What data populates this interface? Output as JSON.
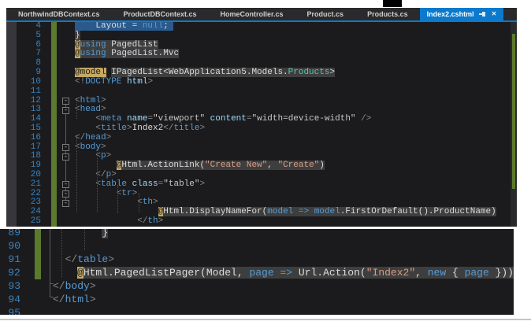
{
  "colors": {
    "accent_blue": "#0b79cc",
    "editor_bg": "#1b1b1d",
    "tab_bg": "#2a2a2c",
    "selection_blue": "#2a5a8c",
    "razor_code_bg": "#3e3e3e",
    "razor_at_bg": "#c4a962",
    "change_bar_green": "#5c7a2d",
    "keyword_blue": "#569cd6",
    "string_brown": "#d69d85",
    "type_teal": "#4ec9b0",
    "line_number_blue": "#3a83c0"
  },
  "tabbar": {
    "tabs": [
      {
        "label": "NorthwindDBContext.cs",
        "active": false
      },
      {
        "label": "ProductDBContext.cs",
        "active": false
      },
      {
        "label": "HomeController.cs",
        "active": false
      },
      {
        "label": "Product.cs",
        "active": false
      },
      {
        "label": "Products.cs",
        "active": false
      },
      {
        "label": "Index2.cshtml",
        "active": true,
        "icons": [
          "pin-icon",
          "close-icon"
        ]
      }
    ]
  },
  "editor_top": {
    "lines": [
      {
        "n": 4,
        "green": true,
        "tokens": [
          {
            "t": "    ",
            "b": "sel"
          },
          {
            "t": "Layout = ",
            "c": "id",
            "b": "sel"
          },
          {
            "t": "null",
            "c": "kw",
            "b": "sel"
          },
          {
            "t": ";",
            "c": "id",
            "b": "sel"
          },
          {
            "t": " ",
            "b": "sel"
          }
        ]
      },
      {
        "n": 5,
        "green": true,
        "tokens": [
          {
            "t": "}",
            "c": "id",
            "b": "ray"
          }
        ]
      },
      {
        "n": 6,
        "green": true,
        "tokens": [
          {
            "t": "@",
            "c": "at",
            "b": "at"
          },
          {
            "t": "using",
            "c": "kw",
            "b": "ray"
          },
          {
            "t": " PagedList",
            "c": "id",
            "b": "ray"
          }
        ]
      },
      {
        "n": 7,
        "green": true,
        "tokens": [
          {
            "t": "@",
            "c": "at",
            "b": "at"
          },
          {
            "t": "using",
            "c": "kw",
            "b": "ray"
          },
          {
            "t": " PagedList.Mvc",
            "c": "id",
            "b": "ray"
          }
        ]
      },
      {
        "n": 8,
        "green": true,
        "tokens": []
      },
      {
        "n": 9,
        "green": true,
        "tokens": [
          {
            "t": "@model",
            "c": "at",
            "b": "at"
          },
          {
            "t": " "
          },
          {
            "t": "IPagedList<WebApplication5.Models.",
            "c": "id",
            "b": "ray"
          },
          {
            "t": "Products",
            "c": "type",
            "b": "ray"
          },
          {
            "t": ">",
            "c": "id",
            "b": "ray"
          }
        ]
      },
      {
        "n": 10,
        "green": true,
        "tokens": [
          {
            "t": "<!",
            "c": "pun"
          },
          {
            "t": "DOCTYPE",
            "c": "kw"
          },
          {
            "t": " "
          },
          {
            "t": "html",
            "c": "attr"
          },
          {
            "t": ">",
            "c": "pun"
          }
        ]
      },
      {
        "n": 11,
        "green": true,
        "tokens": []
      },
      {
        "n": 12,
        "green": true,
        "fold": true,
        "tokens": [
          {
            "t": "<",
            "c": "pun"
          },
          {
            "t": "html",
            "c": "tag"
          },
          {
            "t": ">",
            "c": "pun"
          }
        ]
      },
      {
        "n": 13,
        "green": true,
        "fold": true,
        "tokens": [
          {
            "t": "<",
            "c": "pun"
          },
          {
            "t": "head",
            "c": "tag"
          },
          {
            "t": ">",
            "c": "pun"
          }
        ]
      },
      {
        "n": 14,
        "green": true,
        "tokens": [
          {
            "t": "    "
          },
          {
            "t": "<",
            "c": "pun"
          },
          {
            "t": "meta",
            "c": "tag"
          },
          {
            "t": " "
          },
          {
            "t": "name",
            "c": "attr"
          },
          {
            "t": "=",
            "c": "pun"
          },
          {
            "t": "\"viewport\"",
            "c": "aval"
          },
          {
            "t": " "
          },
          {
            "t": "content",
            "c": "attr"
          },
          {
            "t": "=",
            "c": "pun"
          },
          {
            "t": "\"width=device-width\"",
            "c": "aval"
          },
          {
            "t": " "
          },
          {
            "t": "/>",
            "c": "pun"
          }
        ]
      },
      {
        "n": 15,
        "green": true,
        "tokens": [
          {
            "t": "    "
          },
          {
            "t": "<",
            "c": "pun"
          },
          {
            "t": "title",
            "c": "tag"
          },
          {
            "t": ">",
            "c": "pun"
          },
          {
            "t": "Index2",
            "c": "id"
          },
          {
            "t": "</",
            "c": "pun"
          },
          {
            "t": "title",
            "c": "tag"
          },
          {
            "t": ">",
            "c": "pun"
          }
        ]
      },
      {
        "n": 16,
        "green": true,
        "tokens": [
          {
            "t": "</",
            "c": "pun"
          },
          {
            "t": "head",
            "c": "tag"
          },
          {
            "t": ">",
            "c": "pun"
          }
        ]
      },
      {
        "n": 17,
        "green": true,
        "fold": true,
        "tokens": [
          {
            "t": "<",
            "c": "pun"
          },
          {
            "t": "body",
            "c": "tag"
          },
          {
            "t": ">",
            "c": "pun"
          }
        ]
      },
      {
        "n": 18,
        "green": true,
        "fold": true,
        "tokens": [
          {
            "t": "    "
          },
          {
            "t": "<",
            "c": "pun"
          },
          {
            "t": "p",
            "c": "tag"
          },
          {
            "t": ">",
            "c": "pun"
          }
        ]
      },
      {
        "n": 19,
        "green": true,
        "tokens": [
          {
            "t": "        "
          },
          {
            "t": "@",
            "c": "at",
            "b": "at"
          },
          {
            "t": "Html.ActionLink(",
            "c": "id",
            "b": "ray"
          },
          {
            "t": "\"Create New\"",
            "c": "cstr",
            "b": "ray"
          },
          {
            "t": ", ",
            "c": "id",
            "b": "ray"
          },
          {
            "t": "\"Create\"",
            "c": "cstr",
            "b": "ray"
          },
          {
            "t": ")",
            "c": "id",
            "b": "ray"
          }
        ]
      },
      {
        "n": 20,
        "green": true,
        "tokens": [
          {
            "t": "    "
          },
          {
            "t": "</",
            "c": "pun"
          },
          {
            "t": "p",
            "c": "tag"
          },
          {
            "t": ">",
            "c": "pun"
          }
        ]
      },
      {
        "n": 21,
        "green": true,
        "fold": true,
        "tokens": [
          {
            "t": "    "
          },
          {
            "t": "<",
            "c": "pun"
          },
          {
            "t": "table",
            "c": "tag"
          },
          {
            "t": " "
          },
          {
            "t": "class",
            "c": "attr"
          },
          {
            "t": "=",
            "c": "pun"
          },
          {
            "t": "\"table\"",
            "c": "aval"
          },
          {
            "t": ">",
            "c": "pun"
          }
        ]
      },
      {
        "n": 22,
        "green": true,
        "fold": true,
        "tokens": [
          {
            "t": "        "
          },
          {
            "t": "<",
            "c": "pun"
          },
          {
            "t": "tr",
            "c": "tag"
          },
          {
            "t": ">",
            "c": "pun"
          }
        ]
      },
      {
        "n": 23,
        "green": true,
        "fold": true,
        "tokens": [
          {
            "t": "            "
          },
          {
            "t": "<",
            "c": "pun"
          },
          {
            "t": "th",
            "c": "tag"
          },
          {
            "t": ">",
            "c": "pun"
          }
        ]
      },
      {
        "n": 24,
        "green": true,
        "tokens": [
          {
            "t": "                "
          },
          {
            "t": "@",
            "c": "at",
            "b": "at"
          },
          {
            "t": "Html.DisplayNameFor(",
            "c": "id",
            "b": "ray"
          },
          {
            "t": "model",
            "c": "kw",
            "b": "ray"
          },
          {
            "t": " => ",
            "c": "kw",
            "b": "ray"
          },
          {
            "t": "model",
            "c": "kw",
            "b": "ray"
          },
          {
            "t": ".FirstOrDefault().ProductName",
            "c": "id",
            "b": "ray"
          },
          {
            "t": ")",
            "c": "id",
            "b": "ray"
          }
        ]
      },
      {
        "n": 25,
        "green": true,
        "tokens": [
          {
            "t": "            "
          },
          {
            "t": "</",
            "c": "pun"
          },
          {
            "t": "th",
            "c": "tag"
          },
          {
            "t": ">",
            "c": "pun"
          }
        ]
      }
    ]
  },
  "editor_bottom": {
    "lines": [
      {
        "n": 89,
        "green": true,
        "tokens": [
          {
            "t": "        "
          },
          {
            "t": "}",
            "c": "id",
            "b": "ray"
          }
        ]
      },
      {
        "n": 90,
        "green": true,
        "tokens": []
      },
      {
        "n": 91,
        "green": true,
        "tokens": [
          {
            "t": "  "
          },
          {
            "t": "</",
            "c": "pun"
          },
          {
            "t": "table",
            "c": "tag"
          },
          {
            "t": ">",
            "c": "pun"
          }
        ]
      },
      {
        "n": 92,
        "green": true,
        "tokens": [
          {
            "t": "    "
          },
          {
            "t": "@",
            "c": "at",
            "b": "at"
          },
          {
            "t": "Html.PagedListPager(Model, ",
            "c": "id",
            "b": "ray"
          },
          {
            "t": "page",
            "c": "kw",
            "b": "ray"
          },
          {
            "t": " => ",
            "c": "kw",
            "b": "ray"
          },
          {
            "t": "Url.Action(",
            "c": "id",
            "b": "ray"
          },
          {
            "t": "\"Index2\"",
            "c": "cstr",
            "b": "ray"
          },
          {
            "t": ", ",
            "c": "id",
            "b": "ray"
          },
          {
            "t": "new",
            "c": "kw",
            "b": "ray"
          },
          {
            "t": " { ",
            "c": "id",
            "b": "ray"
          },
          {
            "t": "page",
            "c": "kw",
            "b": "ray"
          },
          {
            "t": " }))",
            "c": "id",
            "b": "ray"
          }
        ]
      },
      {
        "n": 93,
        "green": false,
        "tokens": [
          {
            "t": "</",
            "c": "pun"
          },
          {
            "t": "body",
            "c": "tag"
          },
          {
            "t": ">",
            "c": "pun"
          }
        ]
      },
      {
        "n": 94,
        "green": false,
        "tokens": [
          {
            "t": "</",
            "c": "pun"
          },
          {
            "t": "html",
            "c": "tag"
          },
          {
            "t": ">",
            "c": "pun"
          }
        ]
      },
      {
        "n": 95,
        "green": false,
        "tokens": []
      }
    ]
  }
}
